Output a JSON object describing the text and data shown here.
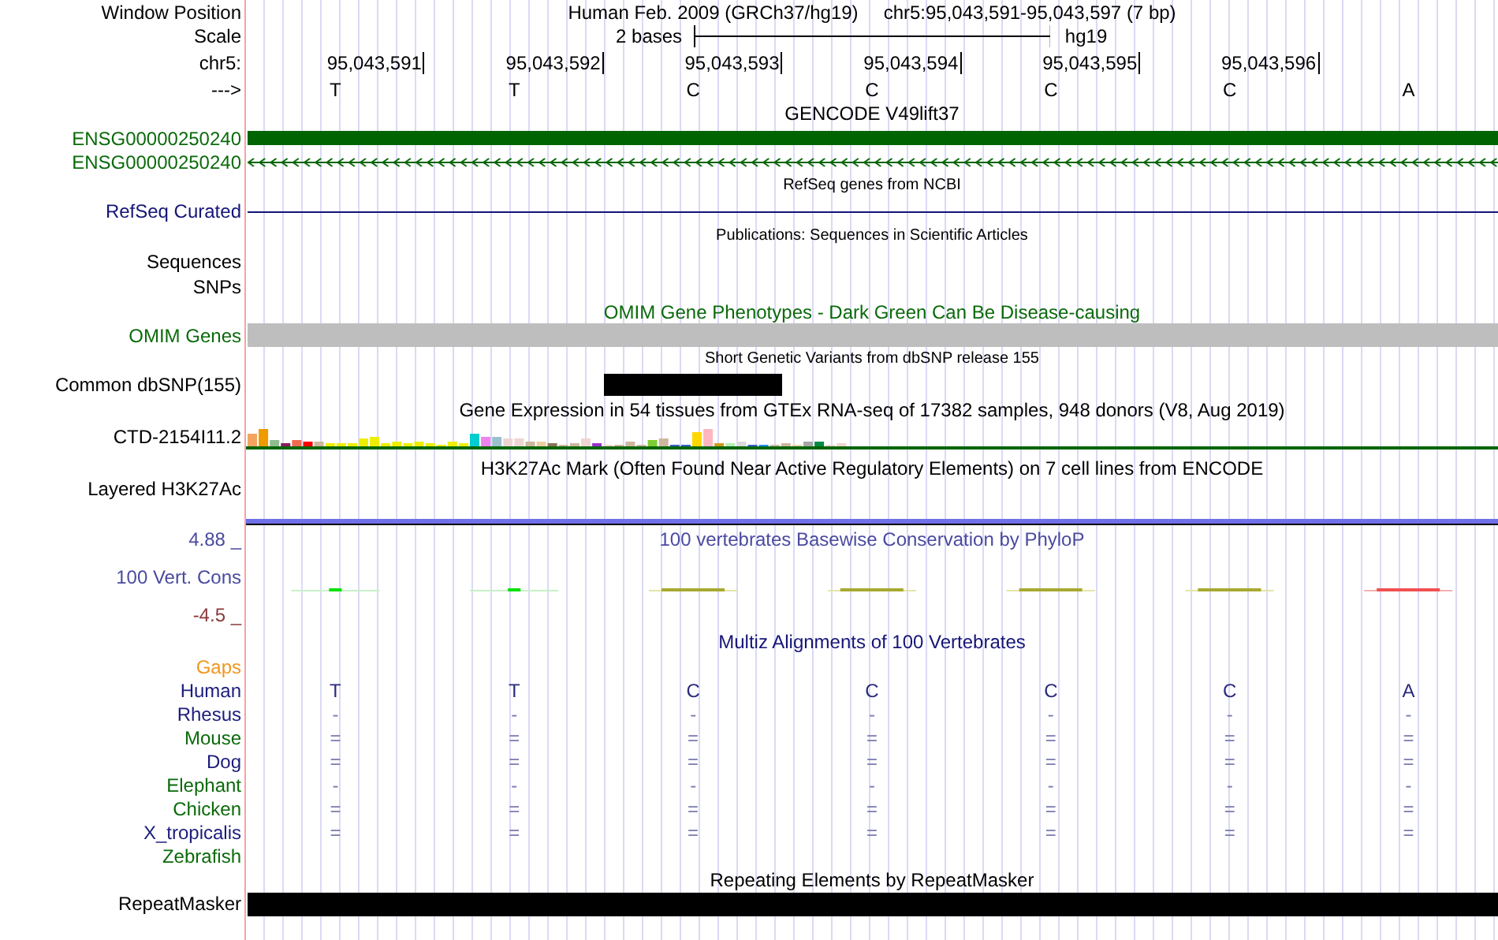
{
  "header": {
    "window_position": {
      "label": "Window Position",
      "assembly": "Human Feb. 2009 (GRCh37/hg19)",
      "range": "chr5:95,043,591-95,043,597 (7 bp)"
    },
    "scale": {
      "label": "Scale",
      "span": "2 bases",
      "db": "hg19"
    },
    "coordinates": {
      "label": "chr5:",
      "positions": [
        "95,043,591",
        "95,043,592",
        "95,043,593",
        "95,043,594",
        "95,043,595",
        "95,043,596"
      ]
    },
    "strand": {
      "label": "--->",
      "bases": [
        "T",
        "T",
        "C",
        "C",
        "C",
        "C",
        "A"
      ]
    }
  },
  "tracks": [
    {
      "kind": "gene",
      "title": "GENCODE V49lift37",
      "labels": [
        "ENSG00000250240",
        "ENSG00000250240"
      ]
    },
    {
      "kind": "refseq",
      "title": "RefSeq genes from NCBI",
      "label": "RefSeq Curated"
    },
    {
      "kind": "publications",
      "title": "Publications: Sequences in Scientific Articles",
      "labels": [
        "Sequences",
        "SNPs"
      ]
    },
    {
      "kind": "omim",
      "title": "OMIM Gene Phenotypes - Dark Green Can Be Disease-causing",
      "label": "OMIM Genes"
    },
    {
      "kind": "dbsnp",
      "title": "Short Genetic Variants from dbSNP release 155",
      "label": "Common dbSNP(155)"
    },
    {
      "kind": "gtex",
      "title": "Gene Expression in 54 tissues from GTEx RNA-seq of 17382 samples, 948 donors (V8, Aug 2019)",
      "label": "CTD-2154I11.2"
    },
    {
      "kind": "h3k27ac",
      "title": "H3K27Ac Mark (Often Found Near Active Regulatory Elements) on 7 cell lines from ENCODE",
      "label": "Layered H3K27Ac"
    },
    {
      "kind": "phylop",
      "title": "100 vertebrates Basewise Conservation by PhyloP",
      "label": "100 Vert. Cons",
      "max": "4.88 _",
      "min": "-4.5 _"
    },
    {
      "kind": "multiz",
      "title": "Multiz Alignments of 100 Vertebrates",
      "gaps_label": "Gaps",
      "species": [
        {
          "name": "Human",
          "color": "#1c1c7c",
          "bases": [
            "T",
            "T",
            "C",
            "C",
            "C",
            "C",
            "A"
          ]
        },
        {
          "name": "Rhesus",
          "color": "#1c1c7c",
          "bases": [
            "-",
            "-",
            "-",
            "-",
            "-",
            "-",
            "-"
          ]
        },
        {
          "name": "Mouse",
          "color": "#0a6a0a",
          "bases": [
            "=",
            "=",
            "=",
            "=",
            "=",
            "=",
            "="
          ]
        },
        {
          "name": "Dog",
          "color": "#1c1c7c",
          "bases": [
            "=",
            "=",
            "=",
            "=",
            "=",
            "=",
            "="
          ]
        },
        {
          "name": "Elephant",
          "color": "#0a6a0a",
          "bases": [
            "-",
            "-",
            "-",
            "-",
            "-",
            "-",
            "-"
          ]
        },
        {
          "name": "Chicken",
          "color": "#0a6a0a",
          "bases": [
            "=",
            "=",
            "=",
            "=",
            "=",
            "=",
            "="
          ]
        },
        {
          "name": "X_tropicalis",
          "color": "#1c1c7c",
          "bases": [
            "=",
            "=",
            "=",
            "=",
            "=",
            "=",
            "="
          ]
        },
        {
          "name": "Zebrafish",
          "color": "#0a6a0a"
        }
      ]
    },
    {
      "kind": "repeatmasker",
      "title": "Repeating Elements by RepeatMasker",
      "label": "RepeatMasker"
    }
  ]
}
